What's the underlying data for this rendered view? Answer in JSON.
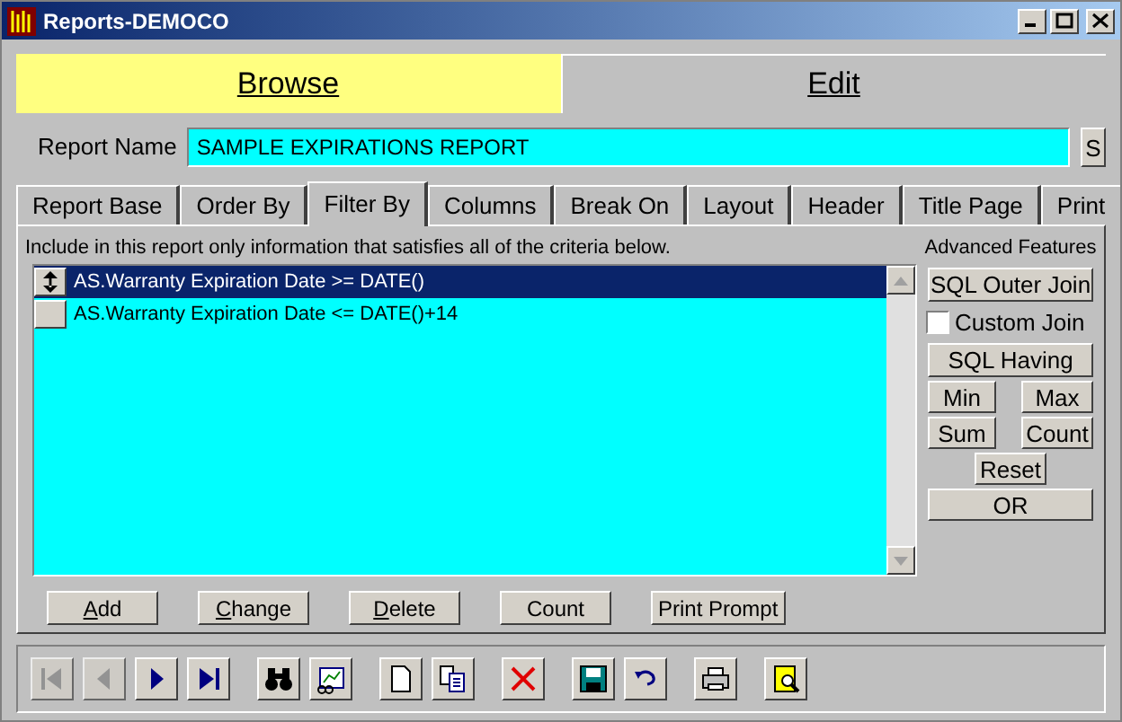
{
  "window": {
    "title": "Reports-DEMOCO"
  },
  "mode_tabs": [
    {
      "label": "Browse",
      "selected": false
    },
    {
      "label": "Edit",
      "selected": true
    }
  ],
  "report_name": {
    "label": "Report Name",
    "value": "SAMPLE EXPIRATIONS REPORT",
    "side_button": "S"
  },
  "tabs": [
    {
      "label": "Report Base",
      "selected": false
    },
    {
      "label": "Order By",
      "selected": false
    },
    {
      "label": "Filter By",
      "selected": true
    },
    {
      "label": "Columns",
      "selected": false
    },
    {
      "label": "Break On",
      "selected": false
    },
    {
      "label": "Layout",
      "selected": false
    },
    {
      "label": "Header",
      "selected": false
    },
    {
      "label": "Title Page",
      "selected": false
    },
    {
      "label": "Print",
      "selected": false
    }
  ],
  "instructions": "Include in this report only information that satisfies all of the criteria below.",
  "criteria": [
    {
      "text": "AS.Warranty Expiration Date >= DATE()",
      "selected": true
    },
    {
      "text": "AS.Warranty Expiration Date <= DATE()+14",
      "selected": false
    }
  ],
  "advanced": {
    "title": "Advanced Features",
    "outer_join": "SQL Outer Join",
    "custom_join": {
      "label": "Custom Join",
      "checked": false
    },
    "having": "SQL Having",
    "min": "Min",
    "max": "Max",
    "sum": "Sum",
    "count": "Count",
    "reset": "Reset",
    "or": "OR"
  },
  "actions": [
    {
      "label": "Add",
      "mnemonic": true
    },
    {
      "label": "Change",
      "mnemonic": true
    },
    {
      "label": "Delete",
      "mnemonic": true
    },
    {
      "label": "Count",
      "mnemonic": false
    },
    {
      "label": "Print Prompt",
      "mnemonic": false
    }
  ],
  "toolbar": [
    [
      {
        "kind": "first",
        "disabled": true
      },
      {
        "kind": "prev",
        "disabled": true
      },
      {
        "kind": "next",
        "disabled": false
      },
      {
        "kind": "last",
        "disabled": false
      }
    ],
    [
      {
        "kind": "find",
        "disabled": false
      },
      {
        "kind": "report",
        "disabled": false
      }
    ],
    [
      {
        "kind": "new",
        "disabled": false
      },
      {
        "kind": "copy",
        "disabled": false
      }
    ],
    [
      {
        "kind": "delete",
        "disabled": false
      }
    ],
    [
      {
        "kind": "save",
        "disabled": false
      },
      {
        "kind": "undo",
        "disabled": false
      }
    ],
    [
      {
        "kind": "print",
        "disabled": false
      }
    ],
    [
      {
        "kind": "preview",
        "disabled": false
      }
    ]
  ]
}
